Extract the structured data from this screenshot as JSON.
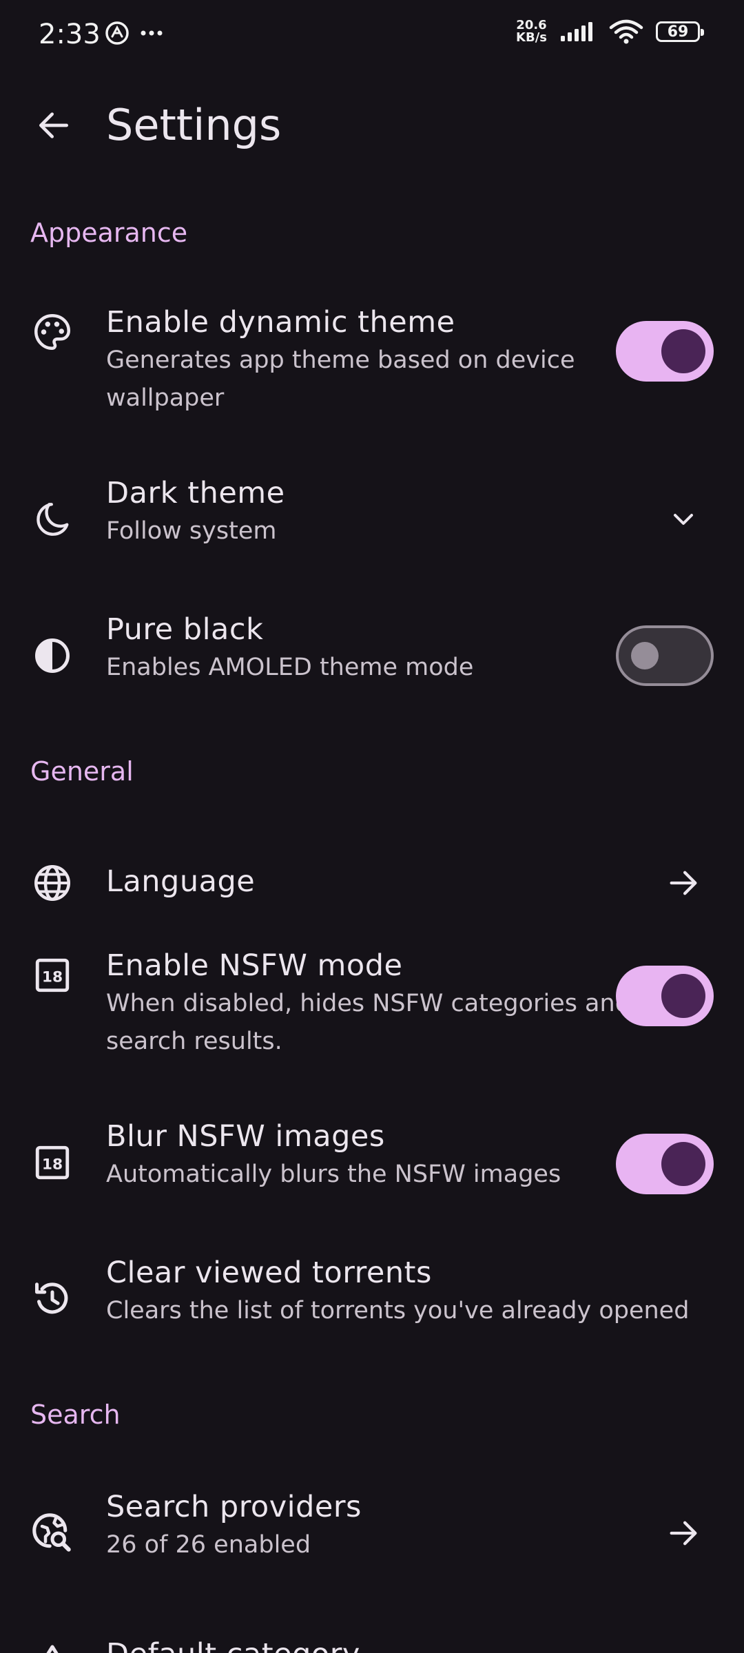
{
  "status_bar": {
    "time": "2:33",
    "net_speed_value": "20.6",
    "net_speed_unit": "KB/s",
    "battery": "69"
  },
  "header": {
    "title": "Settings"
  },
  "sections": {
    "appearance": {
      "title": "Appearance",
      "dynamic_theme": {
        "title": "Enable dynamic theme",
        "subtitle": "Generates app theme based on device wallpaper",
        "enabled": true
      },
      "dark_theme": {
        "title": "Dark theme",
        "subtitle": "Follow system"
      },
      "pure_black": {
        "title": "Pure black",
        "subtitle": "Enables AMOLED theme mode",
        "enabled": false
      }
    },
    "general": {
      "title": "General",
      "language": {
        "title": "Language"
      },
      "nsfw_mode": {
        "title": "Enable NSFW mode",
        "subtitle": "When disabled, hides NSFW categories and search results.",
        "enabled": true
      },
      "blur_nsfw": {
        "title": "Blur NSFW images",
        "subtitle": "Automatically blurs the NSFW images",
        "enabled": true
      },
      "clear_viewed": {
        "title": "Clear viewed torrents",
        "subtitle": "Clears the list of torrents you've already opened"
      }
    },
    "search": {
      "title": "Search",
      "providers": {
        "title": "Search providers",
        "subtitle": "26 of 26 enabled"
      },
      "default_category": {
        "title": "Default category"
      }
    }
  },
  "icons": {
    "back": "arrow-left-icon",
    "palette": "palette-icon",
    "moon": "moon-icon",
    "contrast": "contrast-icon",
    "globe": "globe-icon",
    "eighteen": "eighteen-plus-icon",
    "history": "history-icon",
    "search_provider": "travel-explore-icon",
    "chevron": "chevron-down-icon",
    "arrow_right": "arrow-right-icon"
  },
  "colors": {
    "background": "#151218",
    "accent": "#e6b7f0",
    "toggle_on_track": "#e8b4f2",
    "toggle_on_knob": "#4a2456",
    "toggle_off_outline": "#958d98"
  }
}
